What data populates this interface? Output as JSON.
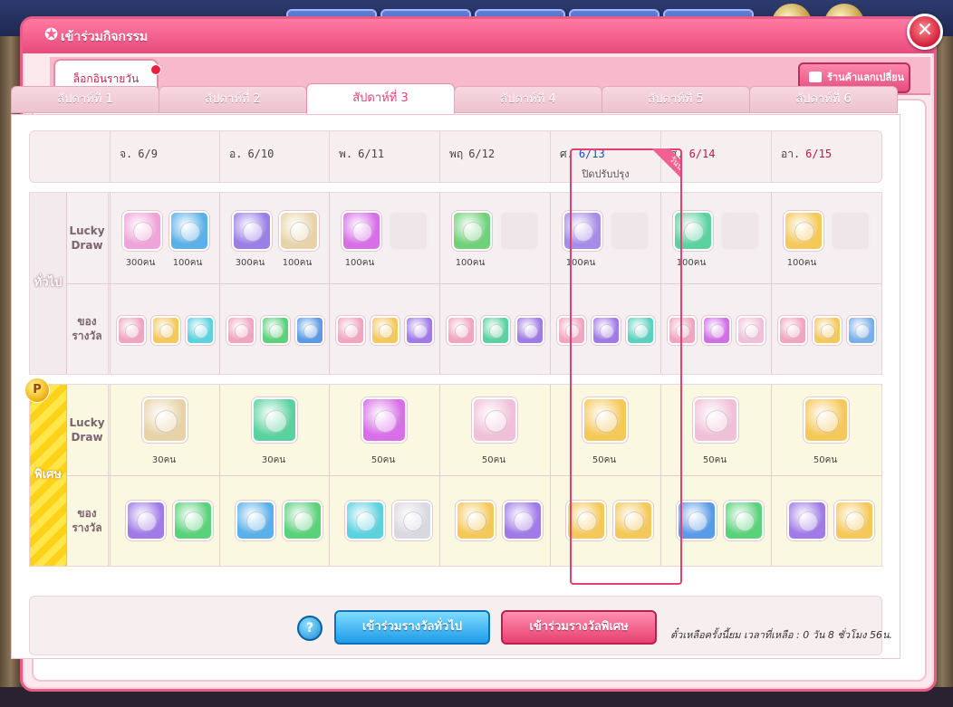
{
  "window": {
    "title": "เข้าร่วมกิจกรรม",
    "close_label": "✕"
  },
  "subnav": {
    "daily_tab": "ล็อกอินรายวัน",
    "shop_button": "ร้านค้าแลกเปลี่ยน"
  },
  "week_tabs": [
    "สัปดาห์ที่ 1",
    "สัปดาห์ที่ 2",
    "สัปดาห์ที่ 3",
    "สัปดาห์ที่ 4",
    "สัปดาห์ที่ 5",
    "สัปดาห์ที่ 6"
  ],
  "active_week_index": 2,
  "days": [
    {
      "day": "จ.",
      "date": "6/9",
      "note": ""
    },
    {
      "day": "อ.",
      "date": "6/10",
      "note": ""
    },
    {
      "day": "พ.",
      "date": "6/11",
      "note": ""
    },
    {
      "day": "พฤ",
      "date": "6/12",
      "note": ""
    },
    {
      "day": "ศ.",
      "date": "6/13",
      "note": "ปิดปรับปรุง"
    },
    {
      "day": "ส.",
      "date": "6/14",
      "note": ""
    },
    {
      "day": "อา.",
      "date": "6/15",
      "note": ""
    }
  ],
  "today_badge": "วันนี้",
  "sections": {
    "general": {
      "label": "ทั่วไป",
      "lucky_draw_label": "Lucky Draw",
      "reward_label": "ของ รางวัล"
    },
    "special": {
      "label": "พิเศษ",
      "lucky_draw_label": "Lucky Draw",
      "reward_label": "ของ รางวัล",
      "badge": "P"
    }
  },
  "general_lucky": [
    {
      "items": [
        {
          "icon": "candy-icon",
          "color": "#f0a3d8"
        },
        {
          "icon": "money-bag-icon",
          "color": "#5ab0e8"
        }
      ],
      "counts": [
        "300คน",
        "100คน"
      ]
    },
    {
      "items": [
        {
          "icon": "gold-coin-icon",
          "color": "#9b7ee8"
        },
        {
          "icon": "pouch-icon",
          "color": "#e8d3a8"
        }
      ],
      "counts": [
        "300คน",
        "100คน"
      ]
    },
    {
      "items": [
        {
          "icon": "blue-gift-icon",
          "color": "#d86ee8"
        },
        {
          "icon": "empty",
          "color": ""
        }
      ],
      "counts": [
        "100คน"
      ]
    },
    {
      "items": [
        {
          "icon": "cracker-icon",
          "color": "#6fd27a"
        },
        {
          "icon": "empty",
          "color": ""
        }
      ],
      "counts": [
        "100คน"
      ]
    },
    {
      "items": [
        {
          "icon": "money-bag-icon",
          "color": "#a78be8"
        },
        {
          "icon": "empty",
          "color": ""
        }
      ],
      "counts": [
        "100คน"
      ]
    },
    {
      "items": [
        {
          "icon": "gift-box-icon",
          "color": "#5ad2a0"
        },
        {
          "icon": "empty",
          "color": ""
        }
      ],
      "counts": [
        "100คน"
      ]
    },
    {
      "items": [
        {
          "icon": "candy-icon",
          "color": "#f5c85a"
        },
        {
          "icon": "empty",
          "color": ""
        }
      ],
      "counts": [
        "100คน"
      ]
    }
  ],
  "general_rewards": [
    [
      {
        "icon": "coupon-icon",
        "color": "#f2a4c0"
      },
      {
        "icon": "candy-icon",
        "color": "#f5c85a"
      },
      {
        "icon": "gift-box-icon",
        "color": "#5ad2e0"
      }
    ],
    [
      {
        "icon": "coupon-icon",
        "color": "#f2a4c0"
      },
      {
        "icon": "m-medal-icon",
        "color": "#5ad27a"
      },
      {
        "icon": "gold-coin-icon",
        "color": "#5a9be8"
      }
    ],
    [
      {
        "icon": "coupon-icon",
        "color": "#f2a4c0"
      },
      {
        "icon": "green-gift-icon",
        "color": "#f5c85a"
      },
      {
        "icon": "cracker-icon",
        "color": "#a07ae8"
      }
    ],
    [
      {
        "icon": "coupon-icon",
        "color": "#f2a4c0"
      },
      {
        "icon": "gift-box-icon",
        "color": "#5ad2a0"
      },
      {
        "icon": "gold-coin-icon",
        "color": "#a07ae8"
      }
    ],
    [
      {
        "icon": "coupon-icon",
        "color": "#f2a4c0"
      },
      {
        "icon": "gold-coin-icon",
        "color": "#a07ae8"
      },
      {
        "icon": "armor-icon",
        "color": "#5ad2c0"
      }
    ],
    [
      {
        "icon": "coupon-icon",
        "color": "#f2a4c0"
      },
      {
        "icon": "card-icon",
        "color": "#d26ee8"
      },
      {
        "icon": "pink-gift-icon",
        "color": "#f0c0d8"
      }
    ],
    [
      {
        "icon": "coupon-icon",
        "color": "#f2a4c0"
      },
      {
        "icon": "candy-icon",
        "color": "#f5c85a"
      },
      {
        "icon": "ring-icon",
        "color": "#7ab0e8"
      }
    ]
  ],
  "special_lucky": [
    {
      "icon": "pouch-icon",
      "color": "#e8d3a8",
      "count": "30คน"
    },
    {
      "icon": "gift-box-icon",
      "color": "#5ad2a0",
      "count": "30คน"
    },
    {
      "icon": "blue-gift-icon",
      "color": "#d86ee8",
      "count": "50คน"
    },
    {
      "icon": "pink-gift-icon",
      "color": "#f0c0d8",
      "count": "50คน"
    },
    {
      "icon": "premium-ticket-icon",
      "color": "#f5c85a",
      "count": "50คน"
    },
    {
      "icon": "pink-gift-icon",
      "color": "#f0c0d8",
      "count": "50คน"
    },
    {
      "icon": "fish-icon",
      "color": "#f5c85a",
      "count": "50คน"
    }
  ],
  "special_rewards": [
    [
      {
        "icon": "chest-icon",
        "color": "#a07ae8"
      },
      {
        "icon": "m-medal-icon",
        "color": "#5ad27a"
      }
    ],
    [
      {
        "icon": "money-bag-icon",
        "color": "#5ab0e8"
      },
      {
        "icon": "m-medal-icon",
        "color": "#5ad27a"
      }
    ],
    [
      {
        "icon": "gift-box-icon",
        "color": "#5ad2e0"
      },
      {
        "icon": "silver-gift-icon",
        "color": "#d8d8e0"
      }
    ],
    [
      {
        "icon": "fish-icon",
        "color": "#f5c85a"
      },
      {
        "icon": "purple-gift-icon",
        "color": "#a07ae8"
      }
    ],
    [
      {
        "icon": "green-gift-icon",
        "color": "#f5c85a"
      },
      {
        "icon": "red-gift-icon",
        "color": "#f5c85a"
      }
    ],
    [
      {
        "icon": "gold-coin-icon",
        "color": "#5a9be8"
      },
      {
        "icon": "m-medal-icon",
        "color": "#5ad27a"
      }
    ],
    [
      {
        "icon": "gold-coin-icon",
        "color": "#a07ae8"
      },
      {
        "icon": "cracker-icon",
        "color": "#f5c85a"
      }
    ]
  ],
  "footer": {
    "help_label": "?",
    "join_general": "เข้าร่วมรางวัลทั่วไป",
    "join_special": "เข้าร่วมรางวัลพิเศษ",
    "timer": "ตั๋วเหลือครั้งนี้ยม เวลาที่เหลือ : 0 วัน 8 ชั่วโมง 56น."
  }
}
